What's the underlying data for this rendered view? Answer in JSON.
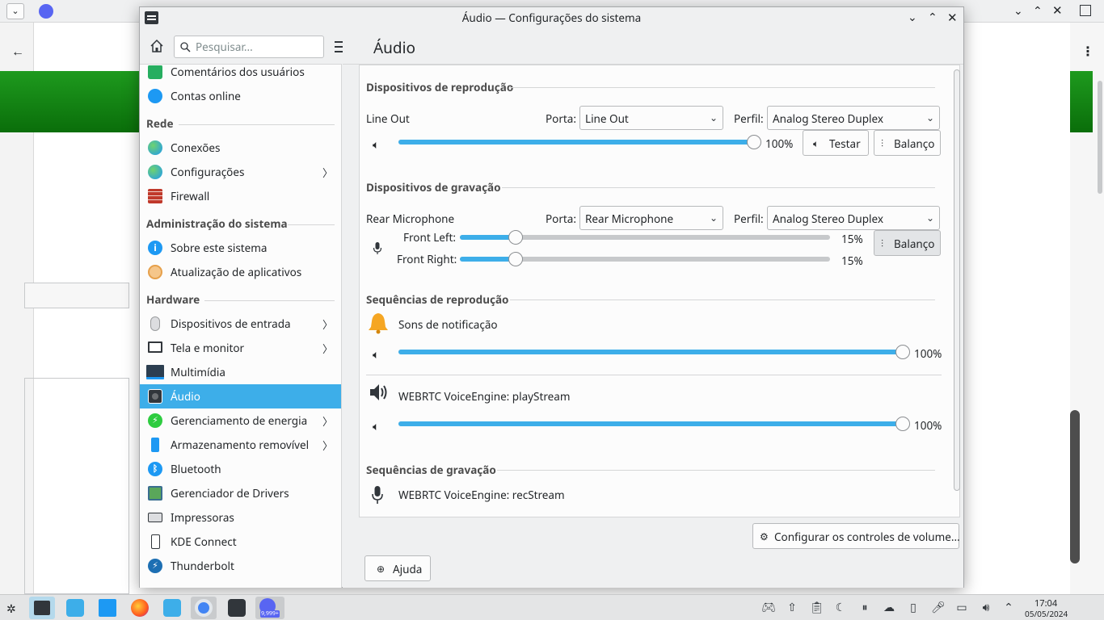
{
  "window": {
    "title": "Áudio — Configurações do sistema",
    "page_title": "Áudio"
  },
  "search": {
    "placeholder": "Pesquisar..."
  },
  "sidebar": {
    "items_top": [
      {
        "label": "Comentários dos usuários",
        "icon": "feedback-icon"
      },
      {
        "label": "Contas online",
        "icon": "online-accounts-icon"
      }
    ],
    "sections": [
      {
        "title": "Rede",
        "items": [
          {
            "label": "Conexões",
            "icon": "globe-icon"
          },
          {
            "label": "Configurações",
            "icon": "globe-icon",
            "arrow": true
          },
          {
            "label": "Firewall",
            "icon": "firewall-icon"
          }
        ]
      },
      {
        "title": "Administração do sistema",
        "items": [
          {
            "label": "Sobre este sistema",
            "icon": "info-icon"
          },
          {
            "label": "Atualização de aplicativos",
            "icon": "update-icon"
          }
        ]
      },
      {
        "title": "Hardware",
        "items": [
          {
            "label": "Dispositivos de entrada",
            "icon": "mouse-icon",
            "arrow": true
          },
          {
            "label": "Tela e monitor",
            "icon": "monitor-icon",
            "arrow": true
          },
          {
            "label": "Multimídia",
            "icon": "multimedia-icon"
          },
          {
            "label": "Áudio",
            "icon": "speaker-icon",
            "selected": true
          },
          {
            "label": "Gerenciamento de energia",
            "icon": "power-icon",
            "arrow": true
          },
          {
            "label": "Armazenamento removível",
            "icon": "usb-icon",
            "arrow": true
          },
          {
            "label": "Bluetooth",
            "icon": "bluetooth-icon"
          },
          {
            "label": "Gerenciador de Drivers",
            "icon": "driver-icon"
          },
          {
            "label": "Impressoras",
            "icon": "printer-icon"
          },
          {
            "label": "KDE Connect",
            "icon": "phone-icon"
          },
          {
            "label": "Thunderbolt",
            "icon": "thunderbolt-icon"
          }
        ]
      }
    ]
  },
  "playback_devices": {
    "title": "Dispositivos de reprodução",
    "device_name": "Line Out",
    "port_label": "Porta:",
    "port_value": "Line Out",
    "profile_label": "Perfil:",
    "profile_value": "Analog Stereo Duplex",
    "volume": "100%",
    "volume_level": 1.0,
    "test_label": "Testar",
    "balance_label": "Balanço"
  },
  "recording_devices": {
    "title": "Dispositivos de gravação",
    "device_name": "Rear Microphone",
    "port_label": "Porta:",
    "port_value": "Rear Microphone",
    "profile_label": "Perfil:",
    "profile_value": "Analog Stereo Duplex",
    "front_left_label": "Front Left:",
    "front_left_value": "15%",
    "front_left_level": 0.15,
    "front_right_label": "Front Right:",
    "front_right_value": "15%",
    "front_right_level": 0.15,
    "balance_label": "Balanço"
  },
  "playback_streams": {
    "title": "Sequências de reprodução",
    "streams": [
      {
        "name": "Sons de notificação",
        "volume": "100%",
        "level": 1.0
      },
      {
        "name": "WEBRTC VoiceEngine: playStream",
        "volume": "100%",
        "level": 1.0
      }
    ]
  },
  "recording_streams": {
    "title": "Sequências de gravação",
    "stream_name": "WEBRTC VoiceEngine: recStream"
  },
  "footer": {
    "configure_label": "Configurar os controles de volume...",
    "help_label": "Ajuda"
  },
  "taskbar": {
    "time": "17:04",
    "date": "05/05/2024",
    "discord_badge": "9,999+"
  },
  "colors": {
    "accent": "#3daee9",
    "selection": "#3daee9"
  }
}
